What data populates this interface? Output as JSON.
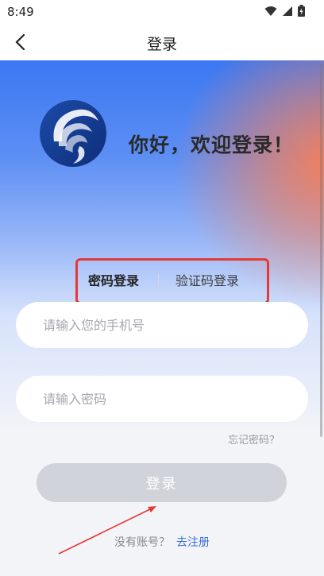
{
  "status_bar": {
    "time": "8:49"
  },
  "nav": {
    "title": "登录"
  },
  "greeting": "你好，欢迎登录！",
  "tabs": {
    "password_login": "密码登录",
    "code_login": "验证码登录"
  },
  "form": {
    "phone_placeholder": "请输入您的手机号",
    "password_placeholder": "请输入密码",
    "forgot_password": "忘记密码？",
    "login_button": "登录"
  },
  "register": {
    "prompt": "没有账号？",
    "link": "去注册"
  },
  "colors": {
    "accent": "#3a6fd8",
    "highlight_box": "#e53935",
    "button_disabled": "#d0d3d9"
  }
}
